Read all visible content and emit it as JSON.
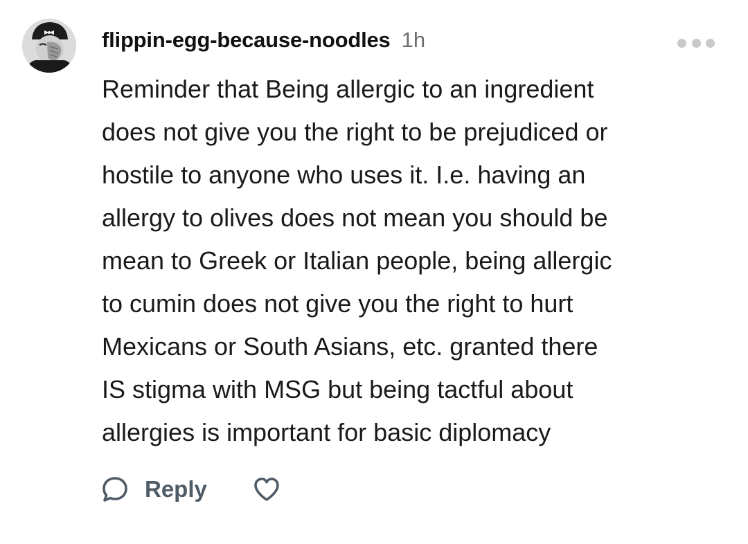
{
  "comment": {
    "username": "flippin-egg-because-noodles",
    "timestamp": "1h",
    "body": "Reminder that Being allergic to an ingredient\ndoes not give you the right to be prejudiced or\nhostile to anyone who uses it. I.e. having an\nallergy to olives does not mean you should be\nmean to Greek or Italian people, being allergic\nto cumin does not give you the right to hurt\nMexicans or South Asians, etc. granted there\nIS stigma with MSG but being tactful about\nallergies is important for basic diplomacy",
    "actions": {
      "reply_label": "Reply",
      "reply_icon": "speech-bubble-icon",
      "like_icon": "heart-icon",
      "more_icon": "more-dots-icon"
    }
  },
  "colors": {
    "username": "#111111",
    "timestamp": "#6b6b6b",
    "body_text": "#1a1a1a",
    "action": "#4f5b66",
    "menu_dots": "#c9c9c9"
  }
}
